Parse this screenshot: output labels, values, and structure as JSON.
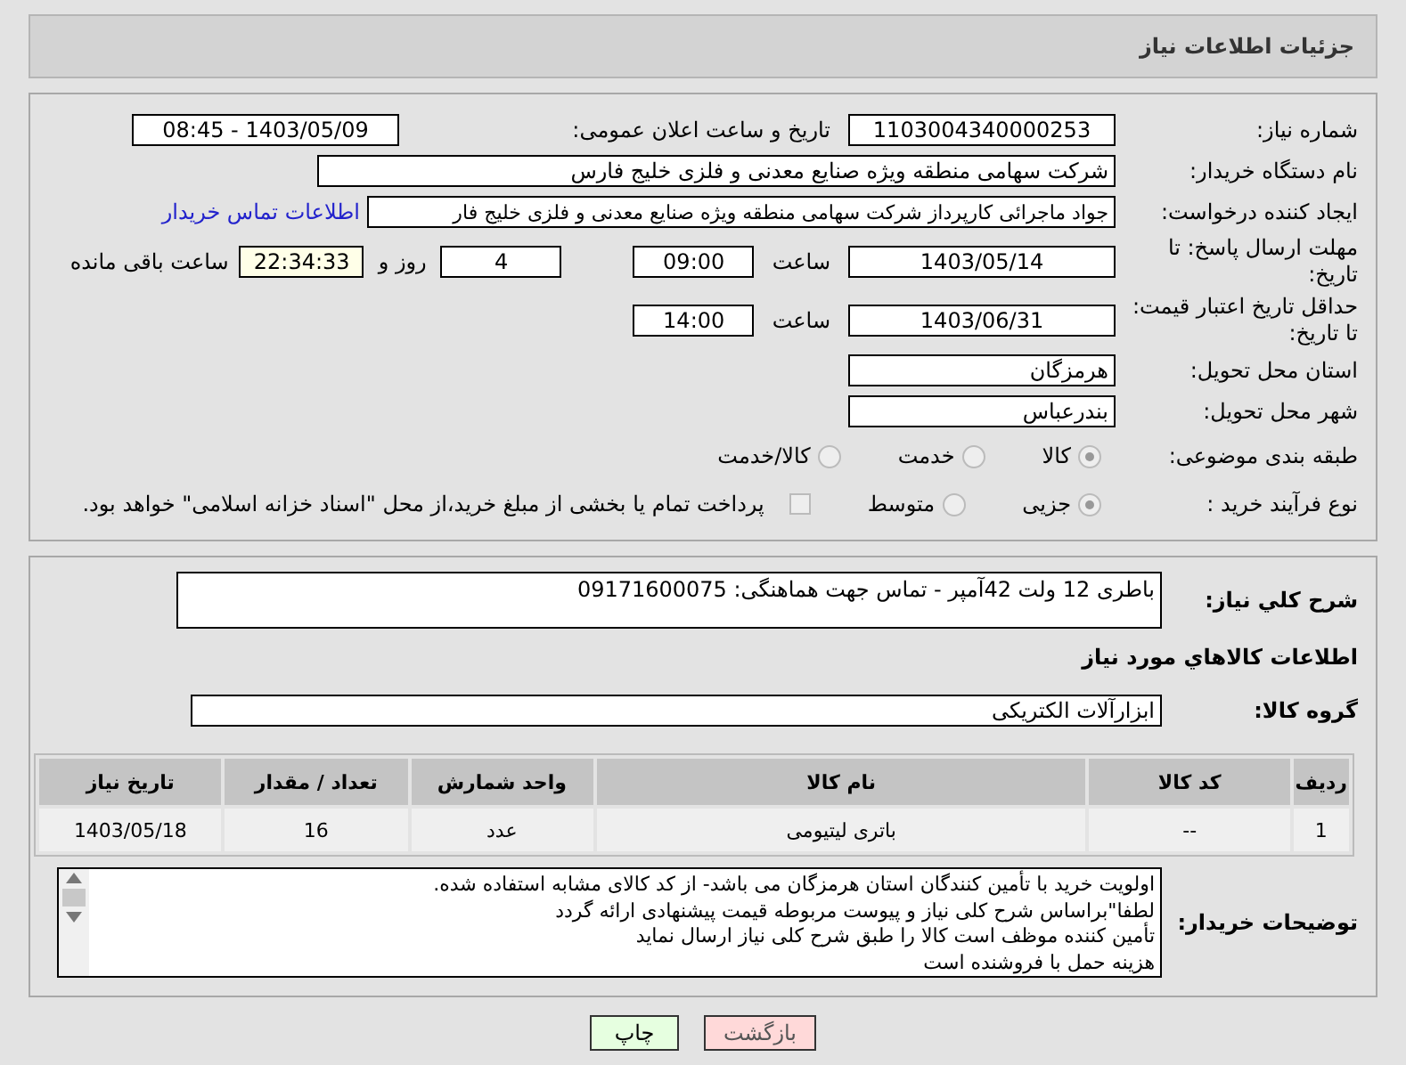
{
  "header": {
    "title": "جزئیات اطلاعات نیاز"
  },
  "need_number": {
    "label": "شماره نیاز:",
    "value": "1103004340000253"
  },
  "announce": {
    "label": "تاریخ و ساعت اعلان عمومی:",
    "value": "1403/05/09 - 08:45"
  },
  "buyer": {
    "label": "نام دستگاه خریدار:",
    "value": "شرکت سهامی منطقه ویژه صنایع معدنی و فلزی خلیج فارس"
  },
  "requester": {
    "label": "ایجاد کننده درخواست:",
    "value": "جواد ماجرائی کارپرداز شرکت سهامی منطقه ویژه صنایع معدنی و فلزی خلیج فار",
    "link": "اطلاعات تماس خریدار"
  },
  "deadline": {
    "label": "مهلت ارسال پاسخ: تا تاریخ:",
    "date": "1403/05/14",
    "time_label": "ساعت",
    "time": "09:00",
    "days": "4",
    "days_label": "روز و",
    "remaining": "22:34:33",
    "remaining_label": "ساعت باقی مانده"
  },
  "price_validity": {
    "label": "حداقل تاریخ اعتبار قیمت: تا تاریخ:",
    "date": "1403/06/31",
    "time_label": "ساعت",
    "time": "14:00"
  },
  "province": {
    "label": "استان محل تحویل:",
    "value": "هرمزگان"
  },
  "city": {
    "label": "شهر محل تحویل:",
    "value": "بندرعباس"
  },
  "category": {
    "label": "طبقه بندی موضوعی:",
    "options": [
      {
        "label": "کالا",
        "selected": true
      },
      {
        "label": "خدمت",
        "selected": false
      },
      {
        "label": "کالا/خدمت",
        "selected": false
      }
    ]
  },
  "process": {
    "label": "نوع فرآیند خرید :",
    "options": [
      {
        "label": "جزیی",
        "selected": true
      },
      {
        "label": "متوسط",
        "selected": false
      }
    ],
    "treasury": {
      "checked": false,
      "text": "پرداخت تمام یا بخشی از مبلغ خرید،از محل \"اسناد خزانه اسلامی\" خواهد بود."
    }
  },
  "description": {
    "label": "شرح کلي نياز:",
    "value": "باطری 12 ولت 42آمپر - تماس جهت هماهنگی: 09171600075"
  },
  "goods_heading": "اطلاعات کالاهاي مورد نياز",
  "goods_group": {
    "label": "گروه کالا:",
    "value": "ابزارآلات الکتریکی"
  },
  "table": {
    "columns": [
      "ردیف",
      "کد کالا",
      "نام کالا",
      "واحد شمارش",
      "تعداد / مقدار",
      "تاریخ نیاز"
    ],
    "rows": [
      [
        "1",
        "--",
        "باتری لیتیومی",
        "عدد",
        "16",
        "1403/05/18"
      ]
    ]
  },
  "buyer_notes": {
    "label": "توضیحات خریدار:",
    "lines": [
      "اولویت خرید با تأمین کنندگان استان هرمزگان می باشد- از کد کالای مشابه استفاده شده.",
      "لطفا\"براساس شرح کلی نیاز و پیوست مربوطه قیمت پیشنهادی ارائه گردد",
      "تأمین کننده موظف است کالا را طبق شرح کلی نیاز ارسال نماید",
      "هزینه حمل با فروشنده است"
    ]
  },
  "buttons": [
    {
      "label": "بازگشت",
      "kind": "back"
    },
    {
      "label": "چاپ",
      "kind": "print"
    }
  ]
}
